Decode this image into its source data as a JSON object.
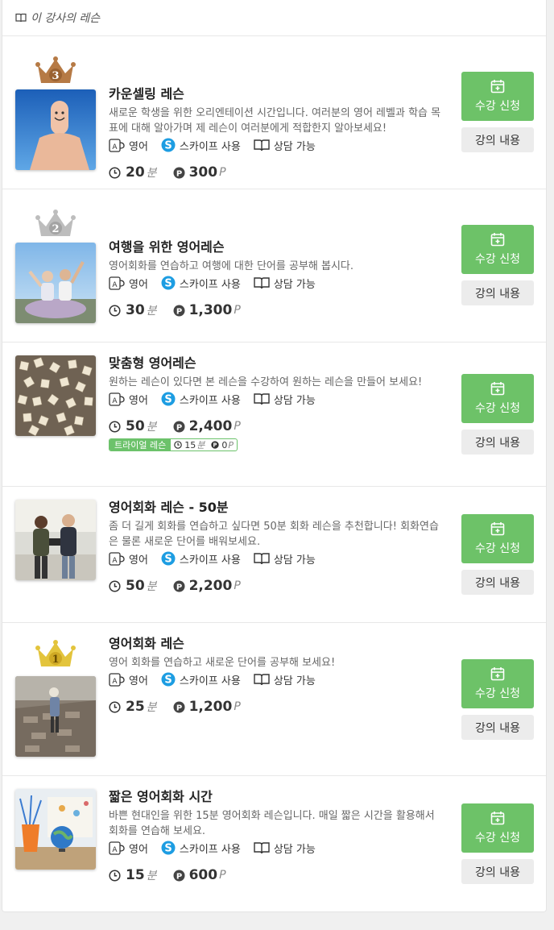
{
  "section": {
    "title": "이 강사의 레슨",
    "icon": "book-icon"
  },
  "colors": {
    "accent": "#6dc268",
    "gold": "#e3c43c",
    "silver": "#b7b7b7",
    "bronze": "#b67a45"
  },
  "lessons": [
    {
      "title": "카운셀링 레슨",
      "description": "새로운 학생을 위한 오리엔테이션 시간입니다. 여러분의 영어 레벨과 학습 목표에 대해 알아가며 제 레슨이 여러분에게 적합한지 알아보세요!",
      "rank": "3",
      "tags": {
        "language": "영어",
        "tool": "스카이프 사용",
        "consult": "상담 가능"
      },
      "minutes": "20",
      "minutes_unit": "분",
      "points": "300",
      "points_unit": "P",
      "enroll_label": "수강 신청",
      "detail_label": "강의 내용"
    },
    {
      "title": "여행을 위한 영어레슨",
      "description": "영어회화를 연습하고 여행에 대한 단어를 공부해 봅시다.",
      "rank": "2",
      "tags": {
        "language": "영어",
        "tool": "스카이프 사용",
        "consult": "상담 가능"
      },
      "minutes": "30",
      "minutes_unit": "분",
      "points": "1,300",
      "points_unit": "P",
      "enroll_label": "수강 신청",
      "detail_label": "강의 내용"
    },
    {
      "title": "맞춤형 영어레슨",
      "description": "원하는 레슨이 있다면 본 레슨을 수강하여 원하는 레슨을 만들어 보세요!",
      "tags": {
        "language": "영어",
        "tool": "스카이프 사용",
        "consult": "상담 가능"
      },
      "minutes": "50",
      "minutes_unit": "분",
      "points": "2,400",
      "points_unit": "P",
      "trial": {
        "label": "트라이얼 레슨",
        "minutes": "15",
        "minutes_unit": "분",
        "points": "0",
        "points_unit": "P"
      },
      "enroll_label": "수강 신청",
      "detail_label": "강의 내용"
    },
    {
      "title": "영어회화 레슨 - 50분",
      "description": "좀 더 길게 회화를 연습하고 싶다면 50분 회화 레슨을 추천합니다! 회화연습은 물론 새로운 단어를 배워보세요.",
      "tags": {
        "language": "영어",
        "tool": "스카이프 사용",
        "consult": "상담 가능"
      },
      "minutes": "50",
      "minutes_unit": "분",
      "points": "2,200",
      "points_unit": "P",
      "enroll_label": "수강 신청",
      "detail_label": "강의 내용"
    },
    {
      "title": "영어회화 레슨",
      "description": "영어 회화를 연습하고 새로운 단어를 공부해 보세요!",
      "rank": "1",
      "tags": {
        "language": "영어",
        "tool": "스카이프 사용",
        "consult": "상담 가능"
      },
      "minutes": "25",
      "minutes_unit": "분",
      "points": "1,200",
      "points_unit": "P",
      "enroll_label": "수강 신청",
      "detail_label": "강의 내용"
    },
    {
      "title": "짧은 영어회화 시간",
      "description": "바쁜 현대인을 위한 15분 영어회화 레슨입니다. 매일 짧은 시간을 활용해서 회화를 연습해 보세요.",
      "tags": {
        "language": "영어",
        "tool": "스카이프 사용",
        "consult": "상담 가능"
      },
      "minutes": "15",
      "minutes_unit": "분",
      "points": "600",
      "points_unit": "P",
      "enroll_label": "수강 신청",
      "detail_label": "강의 내용"
    }
  ]
}
